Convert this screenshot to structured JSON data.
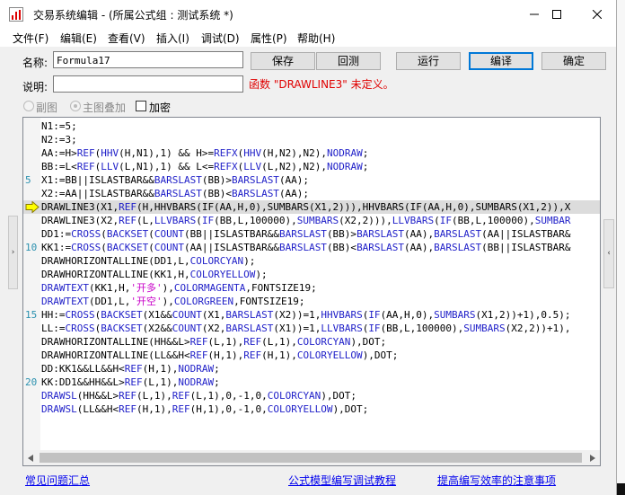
{
  "window": {
    "title": "交易系统编辑 - (所属公式组 : 测试系统 *)",
    "minimize": "minimize",
    "maximize": "maximize",
    "close": "close"
  },
  "menu": [
    "文件(F)",
    "编辑(E)",
    "查看(V)",
    "插入(I)",
    "调试(D)",
    "属性(P)",
    "帮助(H)"
  ],
  "form": {
    "name_label": "名称:",
    "name_value": "Formula17",
    "desc_label": "说明:",
    "desc_value": "",
    "error_text": "函数 \"DRAWLINE3\" 未定义。"
  },
  "buttons": {
    "save": "保存",
    "restore": "回测",
    "run": "运行",
    "compile": "编译",
    "ok": "确定"
  },
  "options": {
    "sub_chart": "副图",
    "main_overlay": "主图叠加",
    "main_overlay_selected": true,
    "encrypt": "加密",
    "encrypt_checked": false
  },
  "editor": {
    "current_line": 7,
    "lines": [
      {
        "n": "",
        "segs": [
          {
            "t": "N1:=5;"
          }
        ]
      },
      {
        "n": "",
        "segs": [
          {
            "t": "N2:=3;"
          }
        ]
      },
      {
        "n": "",
        "segs": [
          {
            "t": "AA:=H>"
          },
          {
            "t": "REF",
            "c": "b"
          },
          {
            "t": "("
          },
          {
            "t": "HHV",
            "c": "b"
          },
          {
            "t": "(H,N1),1) && H>="
          },
          {
            "t": "REFX",
            "c": "b"
          },
          {
            "t": "("
          },
          {
            "t": "HHV",
            "c": "b"
          },
          {
            "t": "(H,N2),N2),"
          },
          {
            "t": "NODRAW",
            "c": "b"
          },
          {
            "t": ";"
          }
        ]
      },
      {
        "n": "",
        "segs": [
          {
            "t": "BB:=L<"
          },
          {
            "t": "REF",
            "c": "b"
          },
          {
            "t": "("
          },
          {
            "t": "LLV",
            "c": "b"
          },
          {
            "t": "(L,N1),1) && L<="
          },
          {
            "t": "REFX",
            "c": "b"
          },
          {
            "t": "("
          },
          {
            "t": "LLV",
            "c": "b"
          },
          {
            "t": "(L,N2),N2),"
          },
          {
            "t": "NODRAW",
            "c": "b"
          },
          {
            "t": ";"
          }
        ]
      },
      {
        "n": "5",
        "segs": [
          {
            "t": "X1:=BB||ISLASTBAR&&"
          },
          {
            "t": "BARSLAST",
            "c": "b"
          },
          {
            "t": "(BB)>"
          },
          {
            "t": "BARSLAST",
            "c": "b"
          },
          {
            "t": "(AA);"
          }
        ]
      },
      {
        "n": "",
        "segs": [
          {
            "t": "X2:=AA||ISLASTBAR&&"
          },
          {
            "t": "BARSLAST",
            "c": "b"
          },
          {
            "t": "(BB)<"
          },
          {
            "t": "BARSLAST",
            "c": "b"
          },
          {
            "t": "(AA);"
          }
        ]
      },
      {
        "n": "",
        "segs": [
          {
            "t": "DRAWLINE3(X1,"
          },
          {
            "t": "REF",
            "c": "b"
          },
          {
            "t": "(H,HHVBARS(IF(AA,H,0),SUMBARS(X1,2))),HHVBARS(IF(AA,H,0),SUMBARS(X1,2)),X"
          }
        ]
      },
      {
        "n": "",
        "segs": [
          {
            "t": "DRAWLINE3(X2,"
          },
          {
            "t": "REF",
            "c": "b"
          },
          {
            "t": "(L,"
          },
          {
            "t": "LLVBARS",
            "c": "b"
          },
          {
            "t": "("
          },
          {
            "t": "IF",
            "c": "b"
          },
          {
            "t": "(BB,L,100000),"
          },
          {
            "t": "SUMBARS",
            "c": "b"
          },
          {
            "t": "(X2,2))),"
          },
          {
            "t": "LLVBARS",
            "c": "b"
          },
          {
            "t": "("
          },
          {
            "t": "IF",
            "c": "b"
          },
          {
            "t": "(BB,L,100000),"
          },
          {
            "t": "SUMBAR",
            "c": "b"
          }
        ]
      },
      {
        "n": "",
        "segs": [
          {
            "t": "DD1:="
          },
          {
            "t": "CROSS",
            "c": "b"
          },
          {
            "t": "("
          },
          {
            "t": "BACKSET",
            "c": "b"
          },
          {
            "t": "("
          },
          {
            "t": "COUNT",
            "c": "b"
          },
          {
            "t": "(BB||ISLASTBAR&&"
          },
          {
            "t": "BARSLAST",
            "c": "b"
          },
          {
            "t": "(BB)>"
          },
          {
            "t": "BARSLAST",
            "c": "b"
          },
          {
            "t": "(AA),"
          },
          {
            "t": "BARSLAST",
            "c": "b"
          },
          {
            "t": "(AA||ISLASTBAR&"
          }
        ]
      },
      {
        "n": "10",
        "segs": [
          {
            "t": "KK1:="
          },
          {
            "t": "CROSS",
            "c": "b"
          },
          {
            "t": "("
          },
          {
            "t": "BACKSET",
            "c": "b"
          },
          {
            "t": "("
          },
          {
            "t": "COUNT",
            "c": "b"
          },
          {
            "t": "(AA||ISLASTBAR&&"
          },
          {
            "t": "BARSLAST",
            "c": "b"
          },
          {
            "t": "(BB)<"
          },
          {
            "t": "BARSLAST",
            "c": "b"
          },
          {
            "t": "(AA),"
          },
          {
            "t": "BARSLAST",
            "c": "b"
          },
          {
            "t": "(BB||ISLASTBAR&"
          }
        ]
      },
      {
        "n": "",
        "segs": [
          {
            "t": "DRAWHORIZONTALLINE(DD1,L,"
          },
          {
            "t": "COLORCYAN",
            "c": "b"
          },
          {
            "t": ");"
          }
        ]
      },
      {
        "n": "",
        "segs": [
          {
            "t": "DRAWHORIZONTALLINE(KK1,H,"
          },
          {
            "t": "COLORYELLOW",
            "c": "b"
          },
          {
            "t": ");"
          }
        ]
      },
      {
        "n": "",
        "segs": [
          {
            "t": "DRAWTEXT",
            "c": "b"
          },
          {
            "t": "(KK1,H,"
          },
          {
            "t": "'开多'",
            "c": "m"
          },
          {
            "t": "),"
          },
          {
            "t": "COLORMAGENTA",
            "c": "b"
          },
          {
            "t": ",FONTSIZE19;"
          }
        ]
      },
      {
        "n": "",
        "segs": [
          {
            "t": "DRAWTEXT",
            "c": "b"
          },
          {
            "t": "(DD1,L,"
          },
          {
            "t": "'开空'",
            "c": "m"
          },
          {
            "t": "),"
          },
          {
            "t": "COLORGREEN",
            "c": "b"
          },
          {
            "t": ",FONTSIZE19;"
          }
        ]
      },
      {
        "n": "15",
        "segs": [
          {
            "t": "HH:="
          },
          {
            "t": "CROSS",
            "c": "b"
          },
          {
            "t": "("
          },
          {
            "t": "BACKSET",
            "c": "b"
          },
          {
            "t": "(X1&&"
          },
          {
            "t": "COUNT",
            "c": "b"
          },
          {
            "t": "(X1,"
          },
          {
            "t": "BARSLAST",
            "c": "b"
          },
          {
            "t": "(X2))=1,"
          },
          {
            "t": "HHVBARS",
            "c": "b"
          },
          {
            "t": "("
          },
          {
            "t": "IF",
            "c": "b"
          },
          {
            "t": "(AA,H,0),"
          },
          {
            "t": "SUMBARS",
            "c": "b"
          },
          {
            "t": "(X1,2))+1),0.5);"
          }
        ]
      },
      {
        "n": "",
        "segs": [
          {
            "t": "LL:="
          },
          {
            "t": "CROSS",
            "c": "b"
          },
          {
            "t": "("
          },
          {
            "t": "BACKSET",
            "c": "b"
          },
          {
            "t": "(X2&&"
          },
          {
            "t": "COUNT",
            "c": "b"
          },
          {
            "t": "(X2,"
          },
          {
            "t": "BARSLAST",
            "c": "b"
          },
          {
            "t": "(X1))=1,"
          },
          {
            "t": "LLVBARS",
            "c": "b"
          },
          {
            "t": "("
          },
          {
            "t": "IF",
            "c": "b"
          },
          {
            "t": "(BB,L,100000),"
          },
          {
            "t": "SUMBARS",
            "c": "b"
          },
          {
            "t": "(X2,2))+1),"
          }
        ]
      },
      {
        "n": "",
        "segs": [
          {
            "t": "DRAWHORIZONTALLINE(HH&&L>"
          },
          {
            "t": "REF",
            "c": "b"
          },
          {
            "t": "(L,1),"
          },
          {
            "t": "REF",
            "c": "b"
          },
          {
            "t": "(L,1),"
          },
          {
            "t": "COLORCYAN",
            "c": "b"
          },
          {
            "t": "),DOT;"
          }
        ]
      },
      {
        "n": "",
        "segs": [
          {
            "t": "DRAWHORIZONTALLINE(LL&&H<"
          },
          {
            "t": "REF",
            "c": "b"
          },
          {
            "t": "(H,1),"
          },
          {
            "t": "REF",
            "c": "b"
          },
          {
            "t": "(H,1),"
          },
          {
            "t": "COLORYELLOW",
            "c": "b"
          },
          {
            "t": "),DOT;"
          }
        ]
      },
      {
        "n": "",
        "segs": [
          {
            "t": "DD:KK1&&LL&&H<"
          },
          {
            "t": "REF",
            "c": "b"
          },
          {
            "t": "(H,1),"
          },
          {
            "t": "NODRAW",
            "c": "b"
          },
          {
            "t": ";"
          }
        ]
      },
      {
        "n": "20",
        "segs": [
          {
            "t": "KK:DD1&&HH&&L>"
          },
          {
            "t": "REF",
            "c": "b"
          },
          {
            "t": "(L,1),"
          },
          {
            "t": "NODRAW",
            "c": "b"
          },
          {
            "t": ";"
          }
        ]
      },
      {
        "n": "",
        "segs": [
          {
            "t": "DRAWSL",
            "c": "b"
          },
          {
            "t": "(HH&&L>"
          },
          {
            "t": "REF",
            "c": "b"
          },
          {
            "t": "(L,1),"
          },
          {
            "t": "REF",
            "c": "b"
          },
          {
            "t": "(L,1),0,-1,0,"
          },
          {
            "t": "COLORCYAN",
            "c": "b"
          },
          {
            "t": "),DOT;"
          }
        ]
      },
      {
        "n": "",
        "segs": [
          {
            "t": "DRAWSL",
            "c": "b"
          },
          {
            "t": "(LL&&H<"
          },
          {
            "t": "REF",
            "c": "b"
          },
          {
            "t": "(H,1),"
          },
          {
            "t": "REF",
            "c": "b"
          },
          {
            "t": "(H,1),0,-1,0,"
          },
          {
            "t": "COLORYELLOW",
            "c": "b"
          },
          {
            "t": "),DOT;"
          }
        ]
      }
    ]
  },
  "links": {
    "faq": "常见问题汇总",
    "tutorial": "公式模型编写调试教程",
    "efficiency": "提高编写效率的注意事项"
  },
  "side_tabs": {
    "left": "›",
    "right": "‹"
  },
  "colors": {
    "keyword": "#1f1fc8",
    "string": "#c800c8",
    "error": "#e00000",
    "link": "#0000ee"
  }
}
